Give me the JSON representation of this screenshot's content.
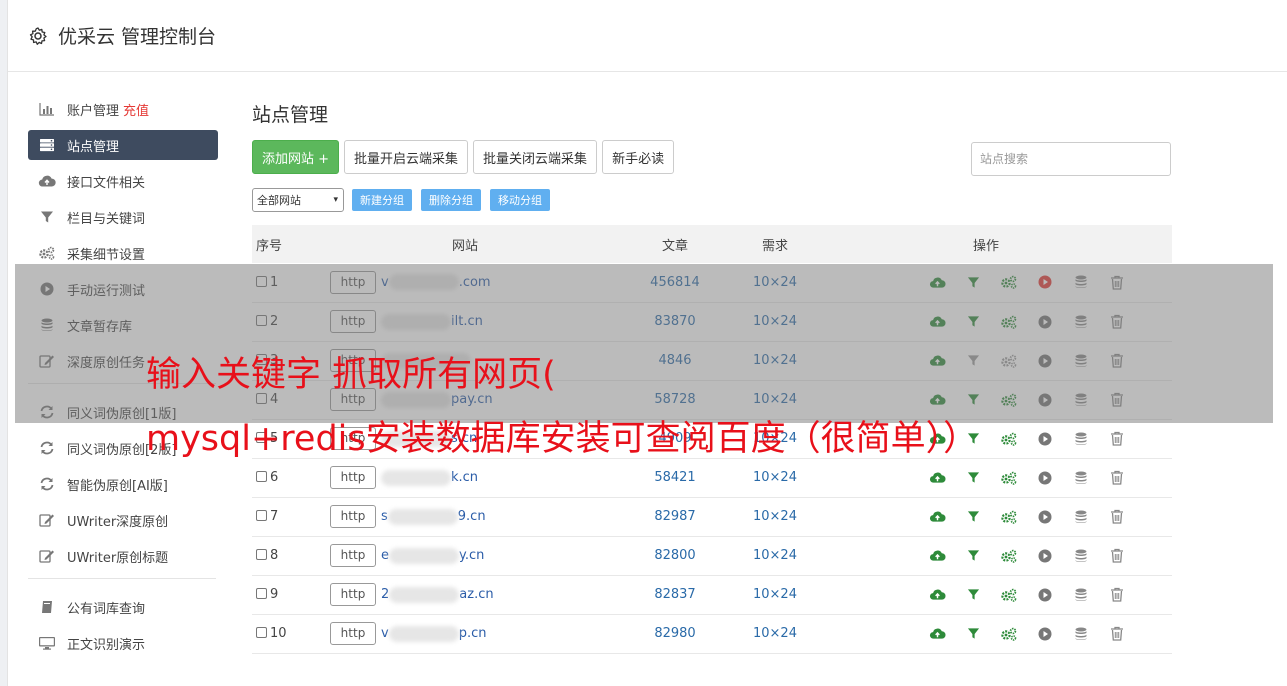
{
  "app": {
    "title": "优采云 管理控制台"
  },
  "sidebar": {
    "groups": [
      [
        {
          "label": "账户管理",
          "extra": "充值",
          "icon": "bar-chart-icon"
        },
        {
          "label": "站点管理",
          "icon": "server-icon",
          "active": true
        },
        {
          "label": "接口文件相关",
          "icon": "cloud-upload-icon"
        },
        {
          "label": "栏目与关键词",
          "icon": "filter-icon"
        },
        {
          "label": "采集细节设置",
          "icon": "cogs-icon"
        },
        {
          "label": "手动运行测试",
          "icon": "play-icon"
        },
        {
          "label": "文章暂存库",
          "icon": "database-icon"
        },
        {
          "label": "深度原创任务",
          "icon": "edit-icon"
        }
      ],
      [
        {
          "label": "同义词伪原创[1版]",
          "icon": "refresh-icon"
        },
        {
          "label": "同义词伪原创[2版]",
          "icon": "refresh-icon"
        },
        {
          "label": "智能伪原创[AI版]",
          "icon": "refresh-icon"
        },
        {
          "label": "UWriter深度原创",
          "icon": "edit-icon"
        },
        {
          "label": "UWriter原创标题",
          "icon": "edit-icon"
        }
      ],
      [
        {
          "label": "公有词库查询",
          "icon": "book-icon"
        },
        {
          "label": "正文识别演示",
          "icon": "monitor-icon"
        }
      ]
    ]
  },
  "main": {
    "title": "站点管理",
    "toolbar": {
      "add": "添加网站 +",
      "batch_on": "批量开启云端采集",
      "batch_off": "批量关闭云端采集",
      "guide": "新手必读"
    },
    "search": {
      "placeholder": "站点搜索"
    },
    "group_select": "全部网站",
    "group_buttons": [
      "新建分组",
      "删除分组",
      "移动分组"
    ],
    "table": {
      "headers": {
        "no": "序号",
        "site": "网站",
        "articles": "文章",
        "need": "需求",
        "ops": "操作"
      },
      "http_label": "http",
      "rows": [
        {
          "no": "1",
          "domain_prefix": "v",
          "domain_suffix": ".com",
          "articles": "456814",
          "need": "10×24",
          "running": true
        },
        {
          "no": "2",
          "domain_prefix": "",
          "domain_suffix": "ilt.cn",
          "articles": "83870",
          "need": "10×24",
          "running": false
        },
        {
          "no": "3",
          "domain_prefix": "",
          "domain_suffix": "",
          "articles": "4846",
          "need": "10×24",
          "running": false,
          "dim": true
        },
        {
          "no": "4",
          "domain_prefix": "",
          "domain_suffix": "pay.cn",
          "articles": "58728",
          "need": "10×24",
          "running": false
        },
        {
          "no": "5",
          "domain_prefix": "",
          "domain_suffix": "s.cn",
          "articles": "4909",
          "need": "10×24",
          "running": false
        },
        {
          "no": "6",
          "domain_prefix": "",
          "domain_suffix": "k.cn",
          "articles": "58421",
          "need": "10×24",
          "running": false
        },
        {
          "no": "7",
          "domain_prefix": "s",
          "domain_suffix": "9.cn",
          "articles": "82987",
          "need": "10×24",
          "running": false
        },
        {
          "no": "8",
          "domain_prefix": "e",
          "domain_suffix": "y.cn",
          "articles": "82800",
          "need": "10×24",
          "running": false
        },
        {
          "no": "9",
          "domain_prefix": "2",
          "domain_suffix": "az.cn",
          "articles": "82837",
          "need": "10×24",
          "running": false
        },
        {
          "no": "10",
          "domain_prefix": "v",
          "domain_suffix": "p.cn",
          "articles": "82980",
          "need": "10×24",
          "running": false
        }
      ]
    }
  },
  "overlay": {
    "line1": "输入关键字 抓取所有网页(",
    "line2": "mysql+redis安装数据库安装可查阅百度（很简单））"
  },
  "colors": {
    "accent_green": "#5cb85c",
    "nav_active": "#3e4b5f",
    "link_blue": "#2a6aa8",
    "overlay_text": "#e8101a",
    "recharge_red": "#e53935"
  }
}
